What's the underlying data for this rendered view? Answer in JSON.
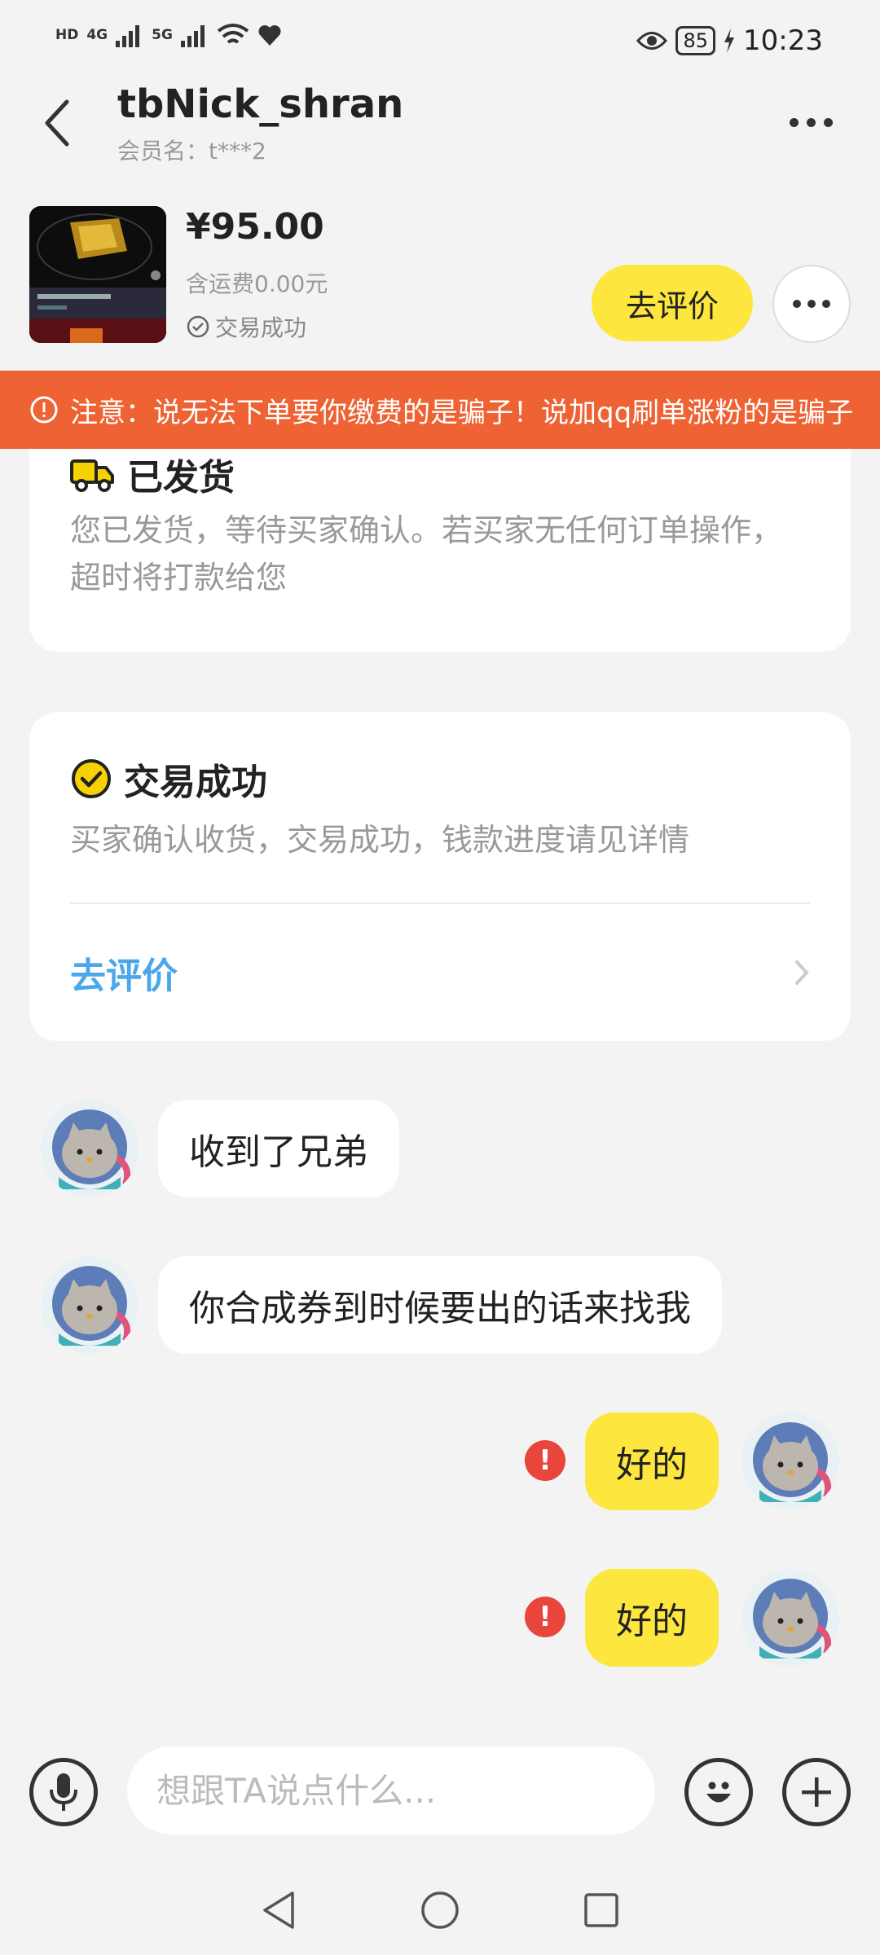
{
  "status_bar": {
    "left_labels": [
      "HD",
      "4G",
      "5G"
    ],
    "battery": "85",
    "time": "10:23"
  },
  "header": {
    "nickname": "tbNick_shran",
    "member_label": "会员名：t***2"
  },
  "product": {
    "price": "¥95.00",
    "shipping": "含运费0.00元",
    "status": "交易成功",
    "review_button": "去评价"
  },
  "warning": {
    "text": "注意：说无法下单要你缴费的是骗子！说加qq刷单涨粉的是骗子"
  },
  "cards": {
    "shipped": {
      "title": "已发货",
      "desc": "您已发货，等待买家确认。若买家无任何订单操作，超时将打款给您"
    },
    "success": {
      "title": "交易成功",
      "desc": "买家确认收货，交易成功，钱款进度请见详情",
      "link": "去评价"
    }
  },
  "messages": [
    {
      "side": "in",
      "text": "收到了兄弟"
    },
    {
      "side": "in",
      "text": "你合成券到时候要出的话来找我"
    },
    {
      "side": "out",
      "text": "好的",
      "error": true
    },
    {
      "side": "out",
      "text": "好的",
      "error": true
    }
  ],
  "input": {
    "placeholder": "想跟TA说点什么..."
  },
  "colors": {
    "accent_yellow": "#fde63d",
    "warning_orange": "#ee6234",
    "link_blue": "#4ca7e9",
    "error_red": "#e8453c"
  }
}
